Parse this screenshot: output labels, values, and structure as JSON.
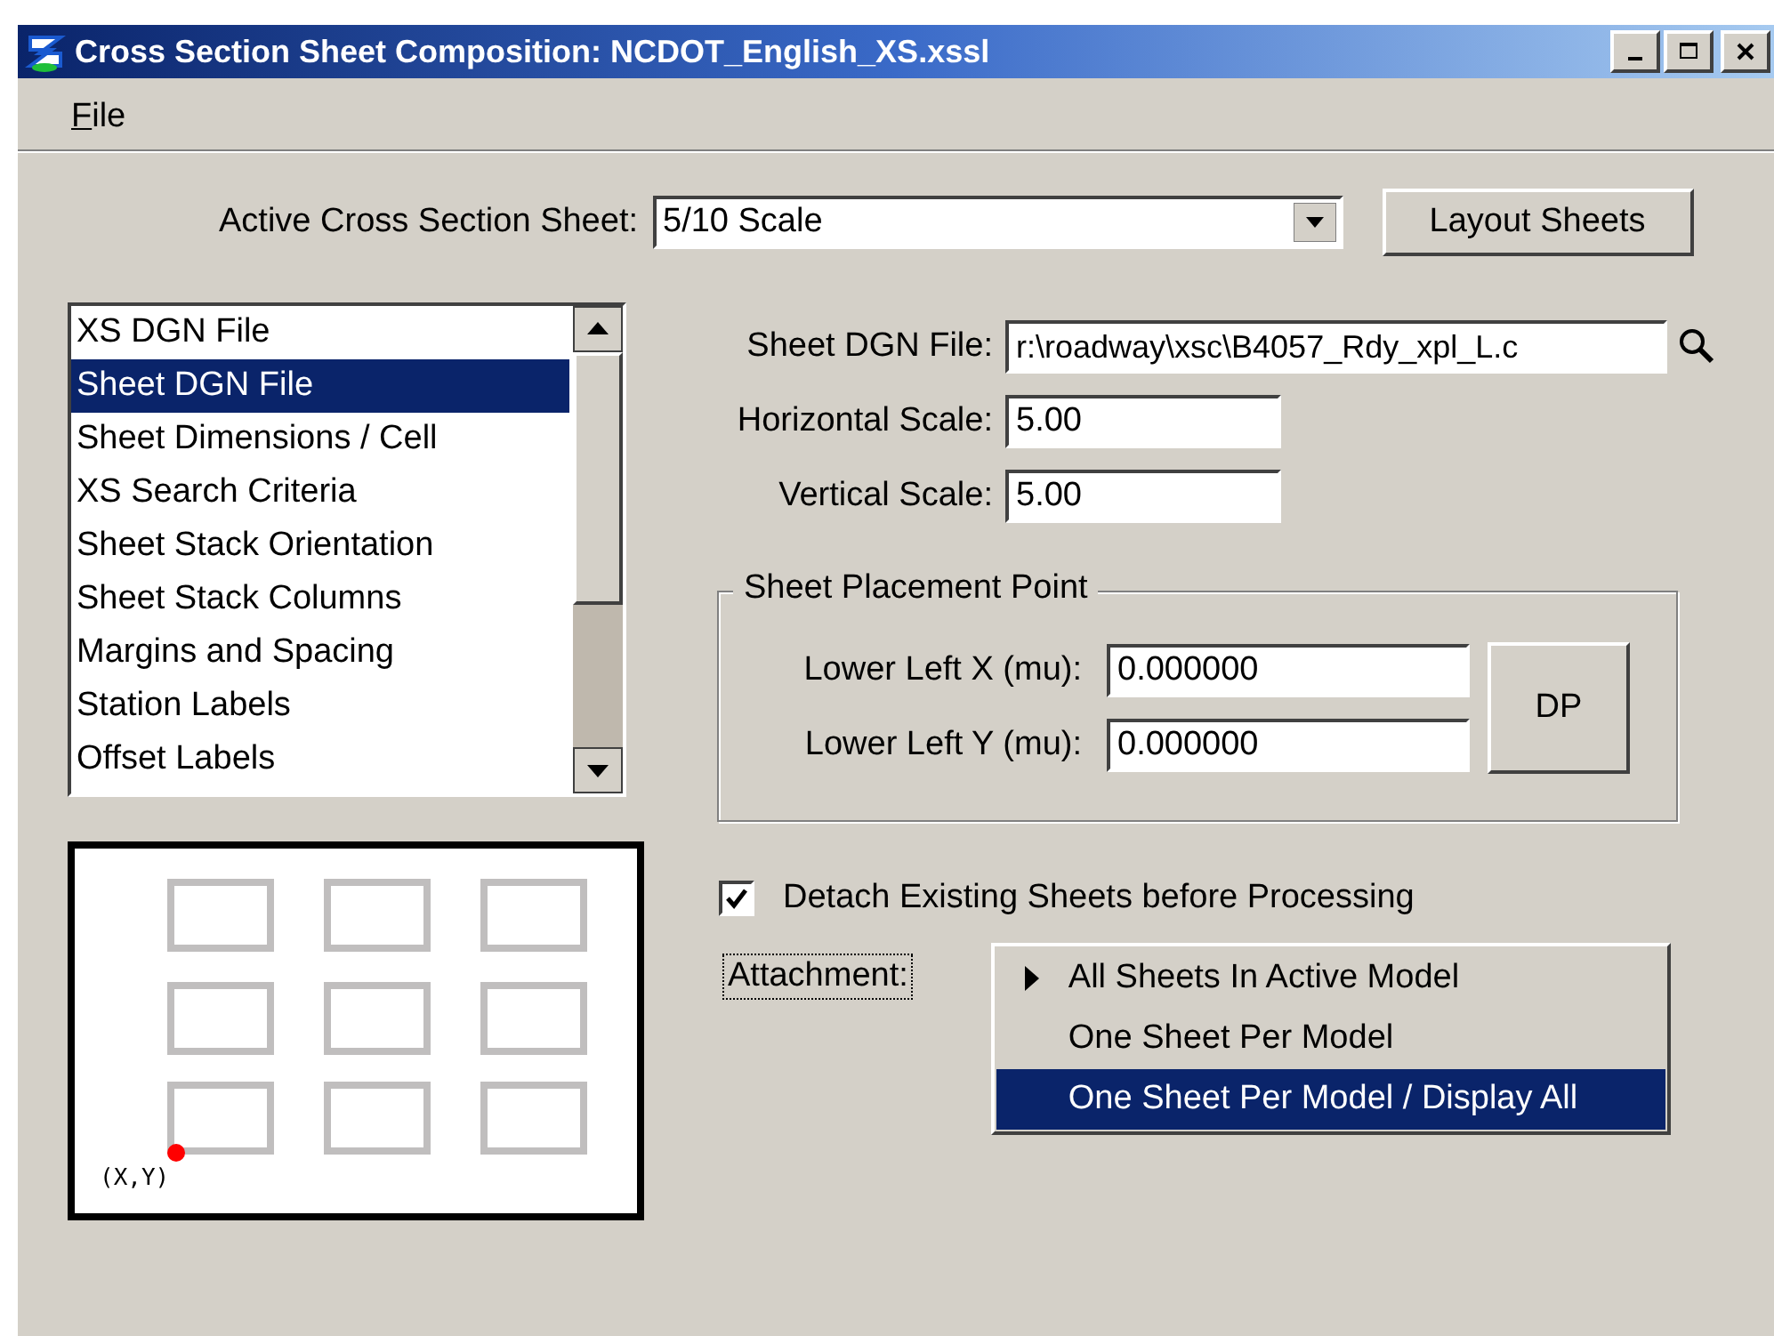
{
  "window": {
    "title": "Cross Section Sheet Composition: NCDOT_English_XS.xssl"
  },
  "menu": [
    {
      "label": "File"
    }
  ],
  "active_sheet": {
    "label": "Active Cross Section Sheet:",
    "value": "5/10 Scale"
  },
  "layout_button": "Layout Sheets",
  "categories": [
    {
      "label": "XS DGN File",
      "selected": false
    },
    {
      "label": "Sheet DGN File",
      "selected": true
    },
    {
      "label": "Sheet Dimensions / Cell",
      "selected": false
    },
    {
      "label": "XS Search Criteria",
      "selected": false
    },
    {
      "label": "Sheet Stack Orientation",
      "selected": false
    },
    {
      "label": "Sheet Stack Columns",
      "selected": false
    },
    {
      "label": "Margins and Spacing",
      "selected": false
    },
    {
      "label": "Station Labels",
      "selected": false
    },
    {
      "label": "Offset Labels",
      "selected": false
    }
  ],
  "preview": {
    "origin_label": "(X,Y)"
  },
  "sheet_file": {
    "label": "Sheet DGN File:",
    "value": "r:\\roadway\\xsc\\B4057_Rdy_xpl_L.c"
  },
  "horizontal_scale": {
    "label": "Horizontal Scale:",
    "value": "5.00"
  },
  "vertical_scale": {
    "label": "Vertical Scale:",
    "value": "5.00"
  },
  "placement": {
    "title": "Sheet Placement Point",
    "fields": [
      {
        "label": "Lower Left X (mu):",
        "value": "0.000000"
      },
      {
        "label": "Lower Left Y (mu):",
        "value": "0.000000"
      }
    ],
    "button": "DP"
  },
  "detach": {
    "label": "Detach Existing Sheets before Processing",
    "checked": true
  },
  "attachment": {
    "label": "Attachment:",
    "focused": true,
    "options": [
      {
        "label": "All Sheets In Active Model",
        "current": true,
        "selected": false
      },
      {
        "label": "One Sheet Per Model",
        "current": false,
        "selected": false
      },
      {
        "label": "One Sheet Per Model / Display All",
        "current": false,
        "selected": true
      }
    ]
  }
}
